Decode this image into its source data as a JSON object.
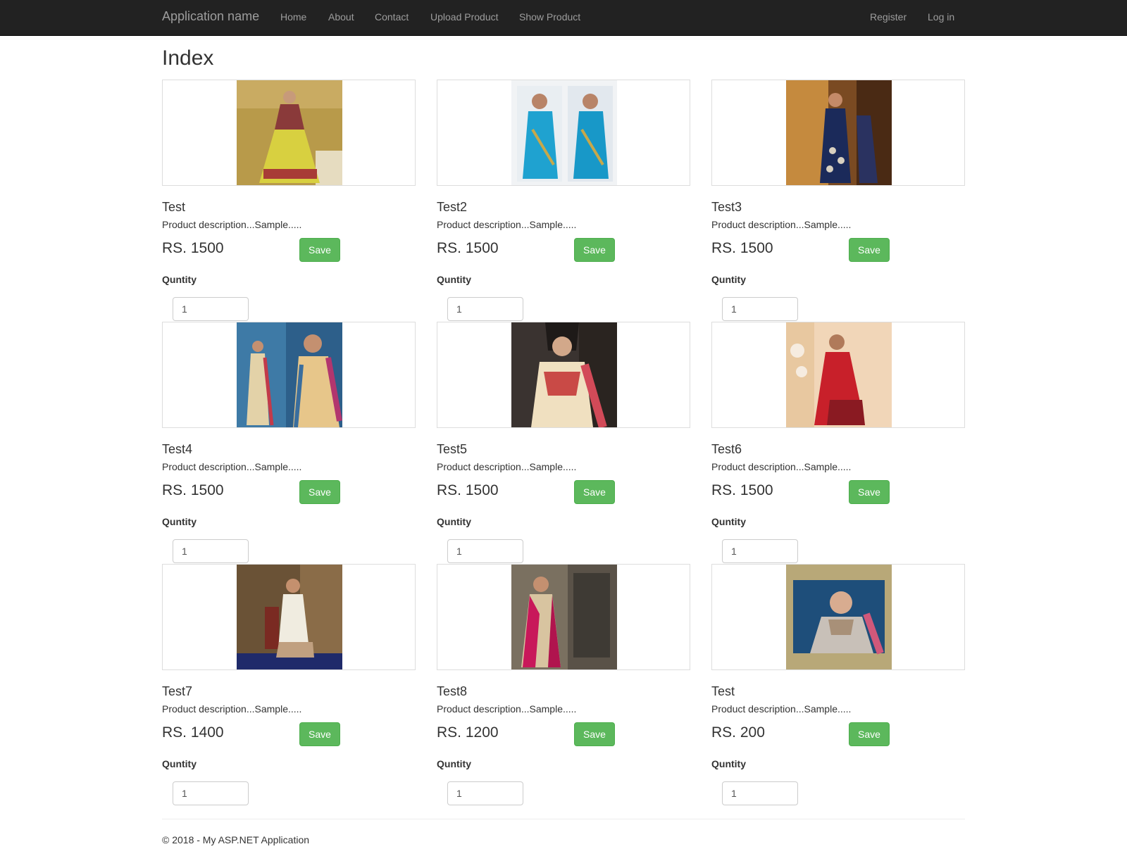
{
  "nav": {
    "brand": "Application name",
    "links": [
      "Home",
      "About",
      "Contact",
      "Upload Product",
      "Show Product"
    ],
    "right_links": [
      "Register",
      "Log in"
    ]
  },
  "page": {
    "title": "Index"
  },
  "products": [
    {
      "name": "Test",
      "description": "Product description...Sample.....",
      "price": "RS. 1500",
      "save_label": "Save",
      "qty_label": "Quntity",
      "qty": "1"
    },
    {
      "name": "Test2",
      "description": "Product description...Sample.....",
      "price": "RS. 1500",
      "save_label": "Save",
      "qty_label": "Quntity",
      "qty": "1"
    },
    {
      "name": "Test3",
      "description": "Product description...Sample.....",
      "price": "RS. 1500",
      "save_label": "Save",
      "qty_label": "Quntity",
      "qty": "1"
    },
    {
      "name": "Test4",
      "description": "Product description...Sample.....",
      "price": "RS. 1500",
      "save_label": "Save",
      "qty_label": "Quntity",
      "qty": "1"
    },
    {
      "name": "Test5",
      "description": "Product description...Sample.....",
      "price": "RS. 1500",
      "save_label": "Save",
      "qty_label": "Quntity",
      "qty": "1"
    },
    {
      "name": "Test6",
      "description": "Product description...Sample.....",
      "price": "RS. 1500",
      "save_label": "Save",
      "qty_label": "Quntity",
      "qty": "1"
    },
    {
      "name": "Test7",
      "description": "Product description...Sample.....",
      "price": "RS. 1400",
      "save_label": "Save",
      "qty_label": "Quntity",
      "qty": "1"
    },
    {
      "name": "Test8",
      "description": "Product description...Sample.....",
      "price": "RS. 1200",
      "save_label": "Save",
      "qty_label": "Quntity",
      "qty": "1"
    },
    {
      "name": "Test",
      "description": "Product description...Sample.....",
      "price": "RS. 200",
      "save_label": "Save",
      "qty_label": "Quntity",
      "qty": "1"
    }
  ],
  "footer": {
    "text": "© 2018 - My ASP.NET Application"
  },
  "colors": {
    "navbar_bg": "#222222",
    "nav_text": "#9d9d9d",
    "save_button": "#5cb85c",
    "thumb_border": "#dddddd"
  }
}
